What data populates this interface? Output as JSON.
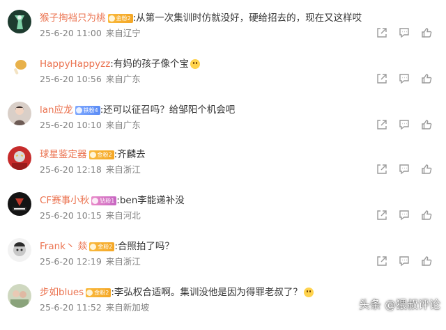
{
  "comments": [
    {
      "username": "猴子掏裆只为桃",
      "badge": "金粉2",
      "badge_style": "gold",
      "text": ":从第一次集训时仿就没好，硬给招去的，现在又这样哎",
      "time": "25-6-20 11:00",
      "location": "来自辽宁",
      "avatar": "dark-icon"
    },
    {
      "username": "HappyHappyzz",
      "badge": "",
      "badge_style": "",
      "text": ":有妈的孩子像个宝",
      "emoji": true,
      "time": "25-6-20 10:56",
      "location": "来自广东",
      "avatar": "chicken-leg-icon"
    },
    {
      "username": "lan应龙",
      "badge": "铁粉4",
      "badge_style": "blue",
      "text": ":还可以征召吗？给邹阳个机会吧",
      "time": "25-6-20 10:10",
      "location": "来自广东",
      "avatar": "portrait-icon"
    },
    {
      "username": "球星鉴定器",
      "badge": "金粉2",
      "badge_style": "gold",
      "text": ":齐麟去",
      "time": "25-6-20 12:18",
      "location": "来自浙江",
      "avatar": "hero-icon"
    },
    {
      "username": "CF赛事小秋",
      "badge": "钻粉1",
      "badge_style": "pink",
      "text": ":ben李能递补没",
      "time": "25-6-20 10:15",
      "location": "来自河北",
      "avatar": "news-logo-icon"
    },
    {
      "username": "Frank丶 燚",
      "badge": "金粉2",
      "badge_style": "gold",
      "text": ":合照拍了吗？",
      "time": "25-6-20 12:19",
      "location": "来自浙江",
      "avatar": "cartoon-icon"
    },
    {
      "username": "步如blues",
      "badge": "金粉2",
      "badge_style": "gold",
      "text": ":李弘权合适啊。集训没他是因为得罪老叔了？",
      "emoji": true,
      "time": "25-6-20 11:52",
      "location": "来自新加坡",
      "avatar": "photo-icon"
    }
  ],
  "actions": {
    "share_icon": "share-icon",
    "comment_icon": "comment-icon",
    "like_icon": "thumbs-up-icon"
  },
  "watermark": "头条 @猥叔评论",
  "colors": {
    "username": "#eb7350",
    "text": "#333333",
    "meta": "#808080",
    "icon": "#9a9a9a"
  }
}
